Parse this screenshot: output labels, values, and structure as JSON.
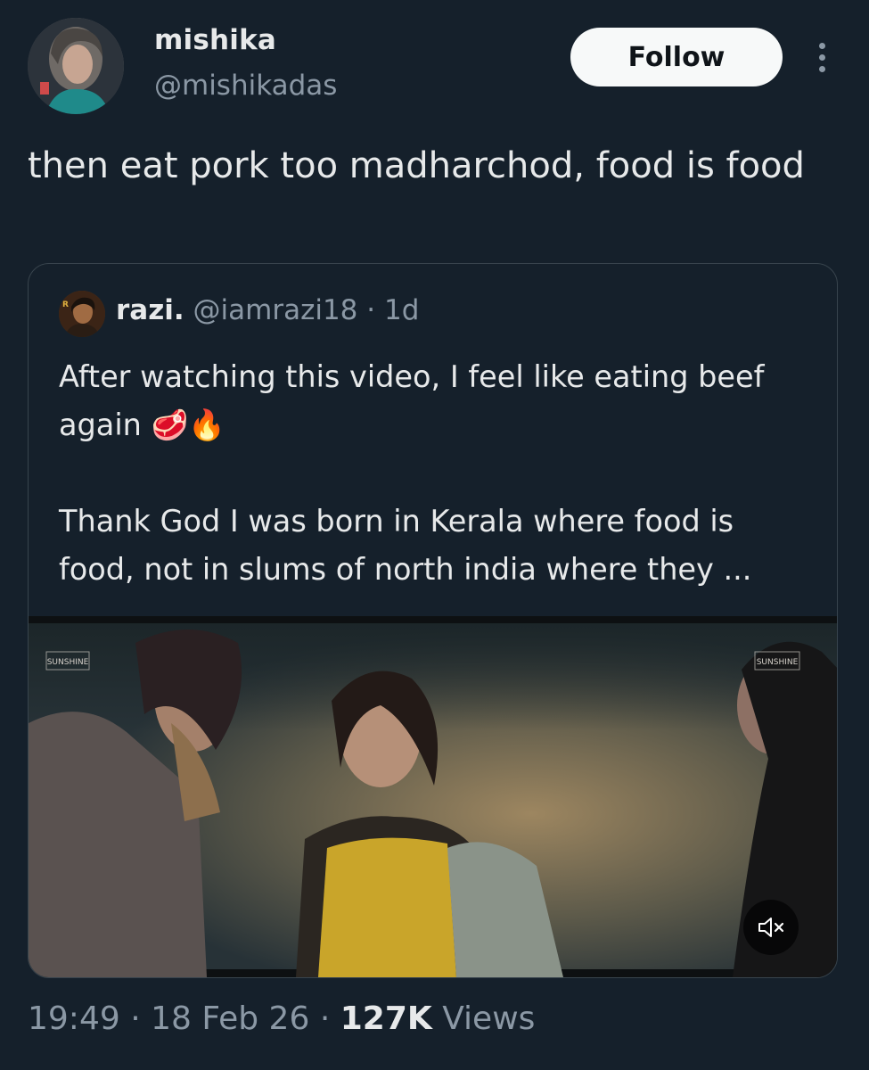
{
  "author": {
    "name": "mishika",
    "handle": "@mishikadas",
    "avatar_icon": "profile-photo"
  },
  "follow_label": "Follow",
  "more_icon": "more-vertical-icon",
  "tweet_text": "then eat pork too madharchod, food is food",
  "quoted_tweet": {
    "name": "razi.",
    "handle": "@iamrazi18",
    "separator": "·",
    "time": "1d",
    "text": "After watching this video, I feel like eating beef again 🥩🔥\n\nThank God I was born in Kerala where food is food, not in slums of north india where they ...",
    "media": {
      "type": "video",
      "watermark_left": "SUNSHINE",
      "watermark_right": "SUNSHINE",
      "mute_icon": "volume-muted-icon"
    }
  },
  "meta": {
    "time": "19:49",
    "sep1": "·",
    "date": "18 Feb 26",
    "sep2": "·",
    "views_count": "127K",
    "views_label": "Views"
  },
  "colors": {
    "background": "#15202b",
    "text_primary": "#e7e9ea",
    "text_secondary": "#8b98a5",
    "border": "#38444d",
    "follow_bg": "#f7f9f9"
  }
}
